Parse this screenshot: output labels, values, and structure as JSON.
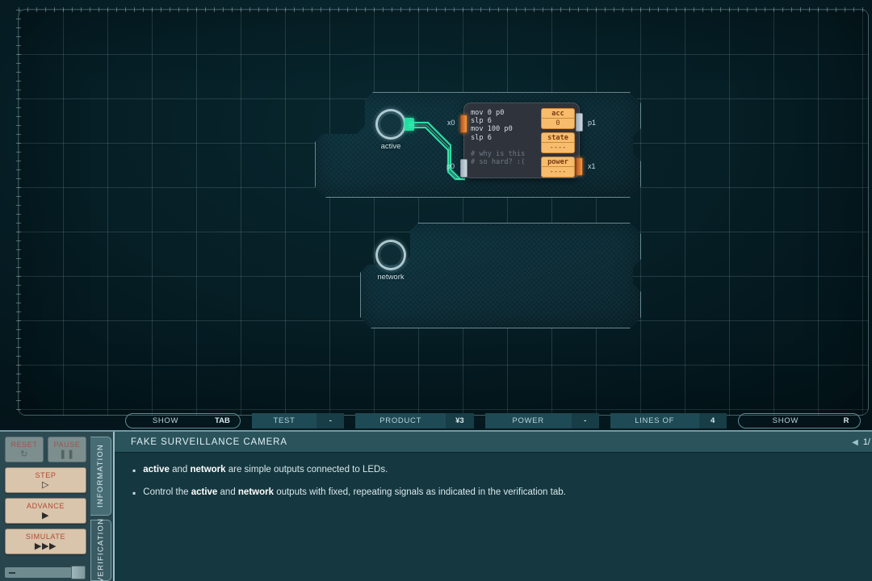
{
  "canvas": {
    "boards": [
      {
        "id": "board-1",
        "led": {
          "label": "active"
        },
        "node": {
          "code": [
            "mov 0 p0",
            "slp 6",
            "mov 100 p0",
            "slp 6"
          ],
          "comments": [
            "# why is this",
            "# so hard? :("
          ],
          "registers": [
            {
              "name": "acc",
              "value": "0"
            },
            {
              "name": "state",
              "value": "----"
            },
            {
              "name": "power",
              "value": "----"
            }
          ],
          "ports": [
            {
              "label": "x0",
              "side": "left",
              "lit": true
            },
            {
              "label": "p0",
              "side": "left",
              "lit": false
            },
            {
              "label": "p1",
              "side": "right",
              "lit": false
            },
            {
              "label": "x1",
              "side": "right",
              "lit": true
            }
          ]
        }
      },
      {
        "id": "board-2",
        "led": {
          "label": "network"
        }
      }
    ]
  },
  "toolbar": {
    "items": [
      {
        "name": "show-wires",
        "label": "SHOW WIRES",
        "value": "TAB",
        "style": "outlined"
      },
      {
        "name": "test-run",
        "label": "TEST RUN",
        "value": "-",
        "style": "filled"
      },
      {
        "name": "product-cost",
        "label": "PRODUCT COST",
        "value": "¥3",
        "style": "filled"
      },
      {
        "name": "power-usage",
        "label": "POWER USAGE",
        "value": "-",
        "style": "filled"
      },
      {
        "name": "lines-of-code",
        "label": "LINES OF CODE",
        "value": "4",
        "style": "filled"
      },
      {
        "name": "show-profiler",
        "label": "SHOW PROFILER",
        "value": "R",
        "style": "outlined"
      }
    ]
  },
  "controls": {
    "reset": {
      "label": "RESET",
      "glyph": "↻",
      "disabled": true
    },
    "pause": {
      "label": "PAUSE",
      "glyph": "❚❚",
      "disabled": true
    },
    "step": {
      "label": "STEP",
      "glyph": "▷",
      "disabled": false
    },
    "advance": {
      "label": "ADVANCE",
      "glyph": "▶",
      "disabled": false
    },
    "simulate": {
      "label": "SIMULATE",
      "glyph": "▶▶▶",
      "disabled": false
    }
  },
  "tabs": [
    {
      "name": "information",
      "label": "INFORMATION",
      "active": true
    },
    {
      "name": "verification",
      "label": "VERIFICATION",
      "active": false
    }
  ],
  "panel": {
    "title": "FAKE SURVEILLANCE CAMERA",
    "pager": {
      "chevron": "◀",
      "page": "1/"
    },
    "bullets": [
      {
        "parts": [
          {
            "text": "active",
            "bold": true
          },
          {
            "text": " and ",
            "bold": false
          },
          {
            "text": "network",
            "bold": true
          },
          {
            "text": " are simple outputs connected to LEDs.",
            "bold": false
          }
        ]
      },
      {
        "parts": [
          {
            "text": "Control the ",
            "bold": false
          },
          {
            "text": "active",
            "bold": true
          },
          {
            "text": " and ",
            "bold": false
          },
          {
            "text": "network",
            "bold": true
          },
          {
            "text": " outputs with fixed, repeating signals as indicated in the verification tab.",
            "bold": false
          }
        ]
      }
    ]
  },
  "colors": {
    "accent_green": "#2de8a8",
    "register_orange": "#f7bc6c",
    "panel_teal": "#15373f",
    "button_tan": "#d9c4ac",
    "button_red_text": "#b04a33"
  }
}
